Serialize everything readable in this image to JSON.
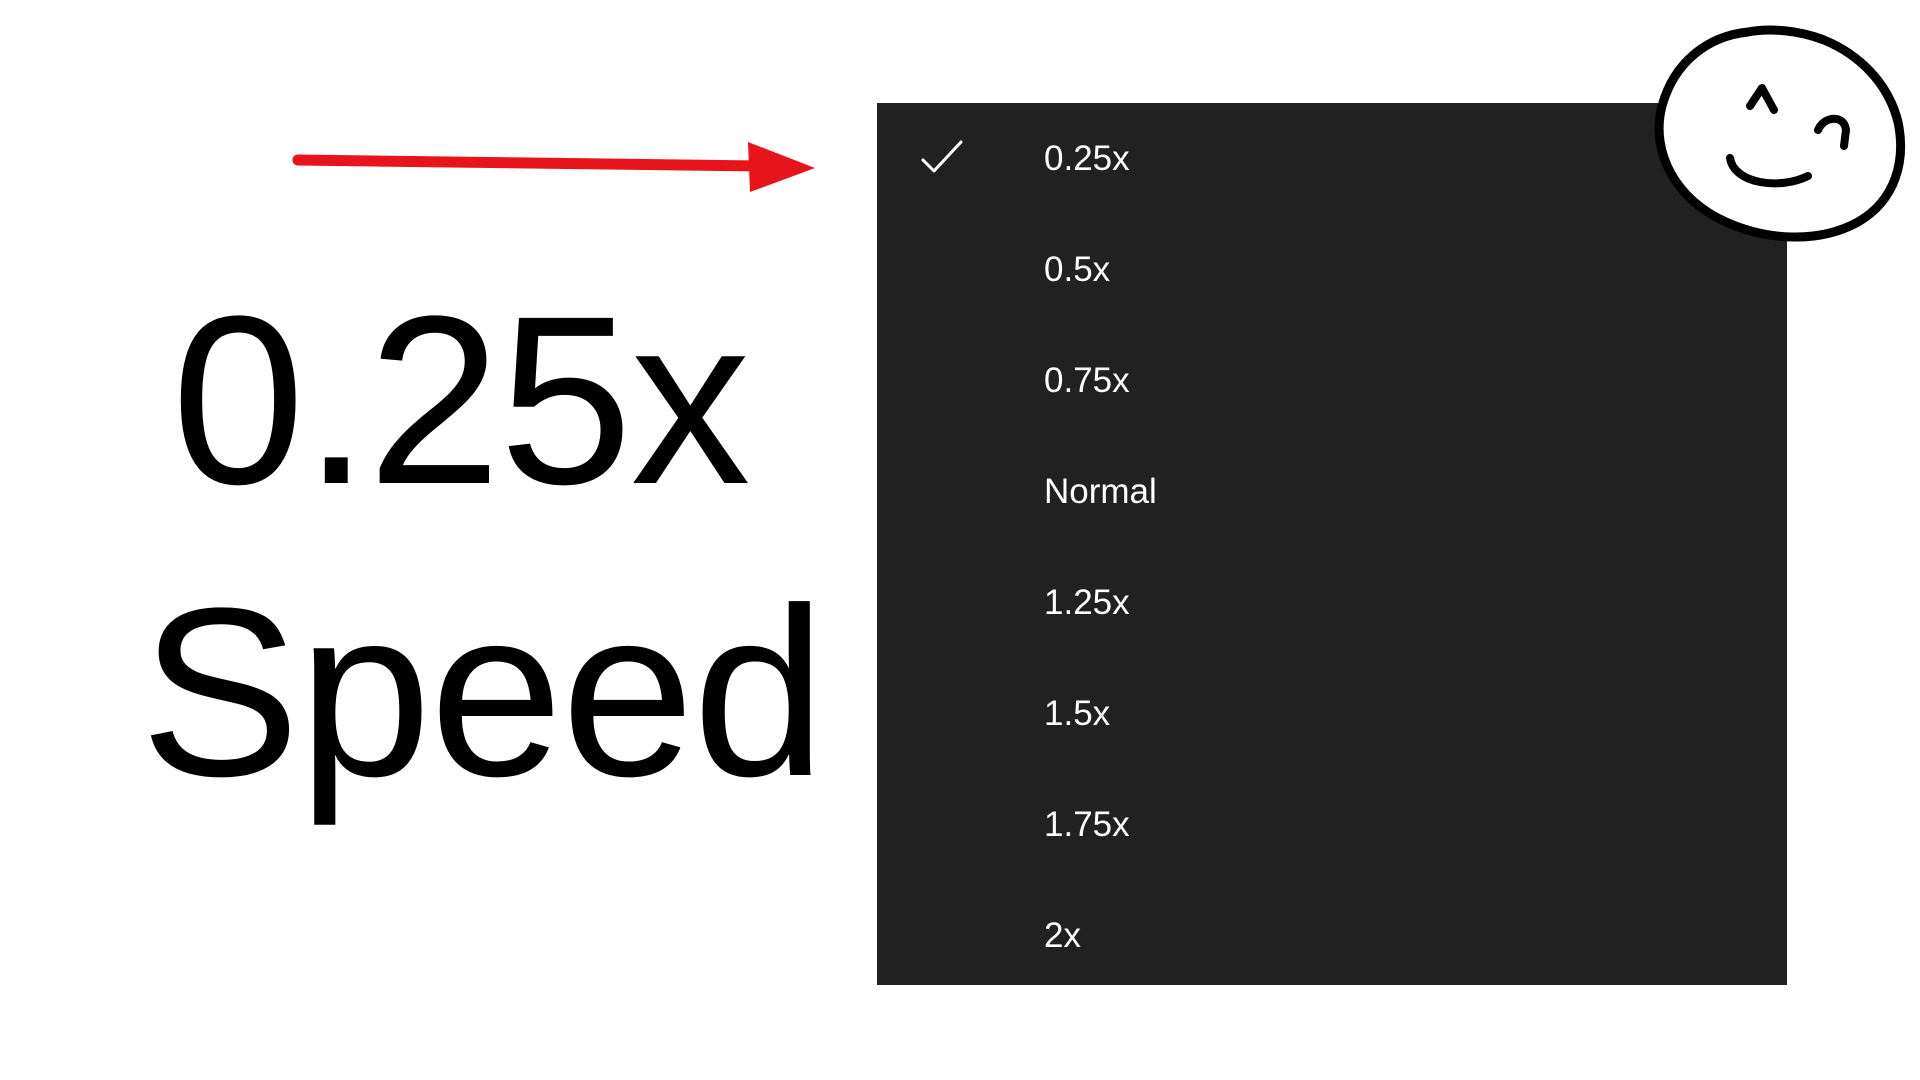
{
  "overlay": {
    "title_line_1": "0.25x",
    "title_line_2": "Speed",
    "arrow_color": "#e8141b",
    "arrow_icon": "right-arrow-icon",
    "smiley_icon": "smiley-face-icon"
  },
  "speed_menu": {
    "background": "#212121",
    "text_color": "#ffffff",
    "selected_index": 0,
    "items": [
      {
        "label": "0.25x",
        "selected": true
      },
      {
        "label": "0.5x",
        "selected": false
      },
      {
        "label": "0.75x",
        "selected": false
      },
      {
        "label": "Normal",
        "selected": false
      },
      {
        "label": "1.25x",
        "selected": false
      },
      {
        "label": "1.5x",
        "selected": false
      },
      {
        "label": "1.75x",
        "selected": false
      },
      {
        "label": "2x",
        "selected": false
      }
    ]
  }
}
